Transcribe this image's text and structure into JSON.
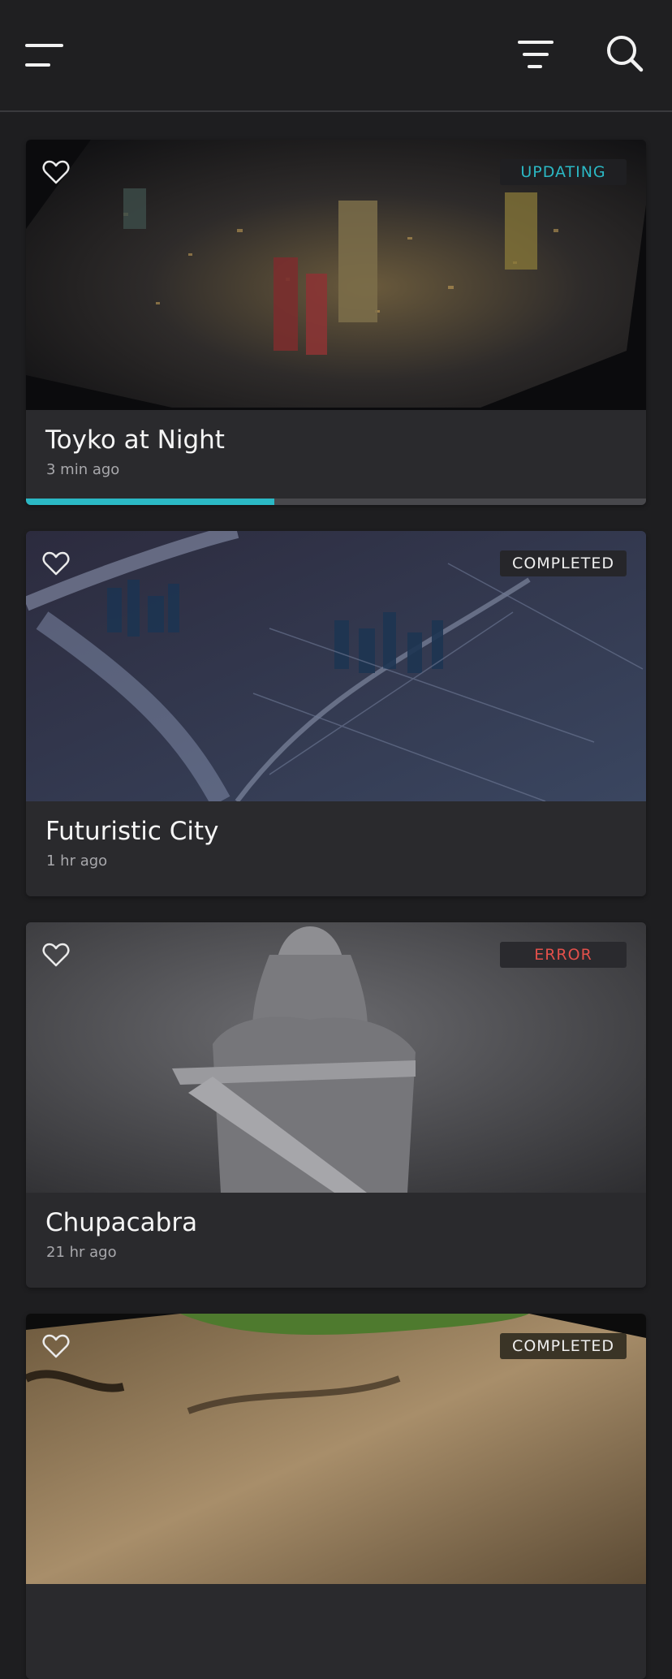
{
  "header": {
    "menu_icon": "menu-icon",
    "filter_icon": "filter-icon",
    "search_icon": "search-icon"
  },
  "cards": [
    {
      "title": "Toyko at Night",
      "time": "3 min ago",
      "status": "UPDATING",
      "status_color": "#2bb8c4",
      "progress": 0.4,
      "favorite": false
    },
    {
      "title": "Futuristic City",
      "time": "1 hr ago",
      "status": "COMPLETED",
      "status_color": "#f0f0f0",
      "favorite": false
    },
    {
      "title": "Chupacabra",
      "time": "21 hr ago",
      "status": "ERROR",
      "status_color": "#e2504b",
      "favorite": false
    },
    {
      "title": "",
      "time": "",
      "status": "COMPLETED",
      "status_color": "#f0f0f0",
      "favorite": false
    }
  ],
  "colors": {
    "accent": "#2bb8c4",
    "background": "#1e1e20",
    "card": "#2a2a2d"
  }
}
